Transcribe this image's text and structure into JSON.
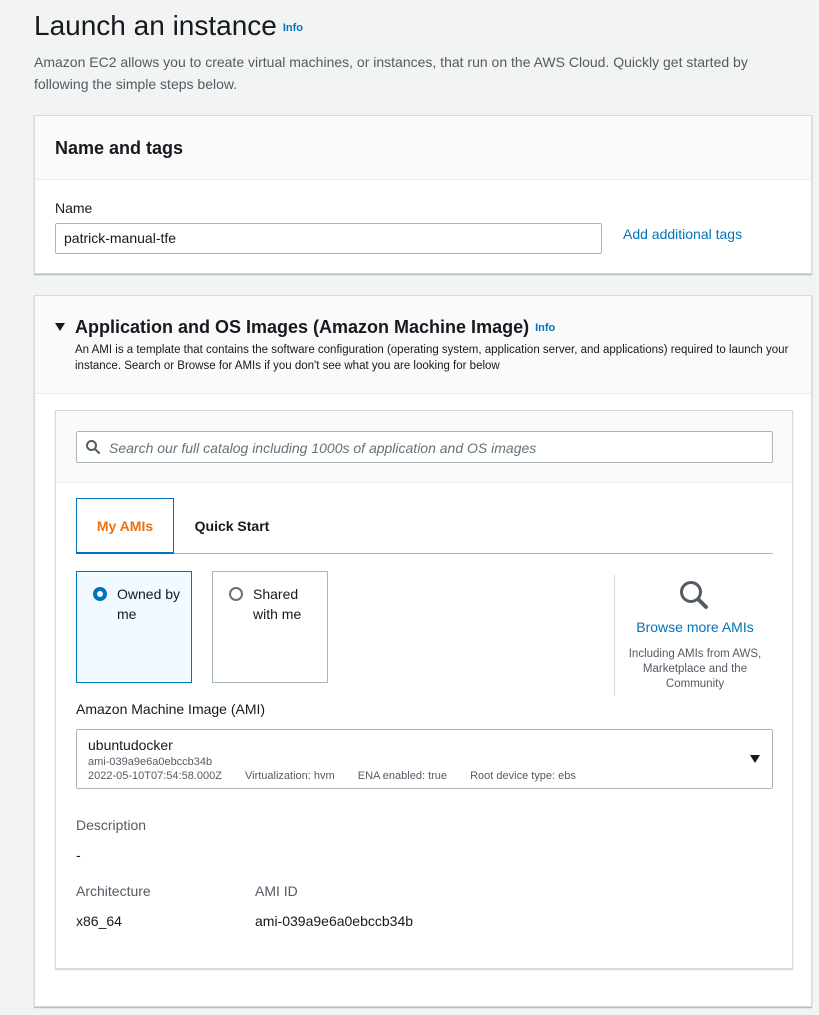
{
  "header": {
    "title": "Launch an instance",
    "info": "Info",
    "description": "Amazon EC2 allows you to create virtual machines, or instances, that run on the AWS Cloud. Quickly get started by following the simple steps below."
  },
  "name_tags": {
    "title": "Name and tags",
    "name_label": "Name",
    "name_value": "patrick-manual-tfe",
    "add_tags": "Add additional tags"
  },
  "ami_section": {
    "title": "Application and OS Images (Amazon Machine Image)",
    "info": "Info",
    "description": "An AMI is a template that contains the software configuration (operating system, application server, and applications) required to launch your instance. Search or Browse for AMIs if you don't see what you are looking for below",
    "search_placeholder": "Search our full catalog including 1000s of application and OS images",
    "tabs": [
      {
        "label": "My AMIs",
        "active": true
      },
      {
        "label": "Quick Start",
        "active": false
      }
    ],
    "owned_by_me": "Owned by me",
    "shared_with_me": "Shared with me",
    "browse_link": "Browse more AMIs",
    "browse_sub": "Including AMIs from AWS, Marketplace and the Community",
    "ami_label": "Amazon Machine Image (AMI)",
    "selected_ami": {
      "name": "ubuntudocker",
      "id": "ami-039a9e6a0ebccb34b",
      "date": "2022-05-10T07:54:58.000Z",
      "virtualization": "Virtualization: hvm",
      "ena": "ENA enabled: true",
      "root_device": "Root device type: ebs"
    },
    "description_label": "Description",
    "description_value": "-",
    "architecture_label": "Architecture",
    "architecture_value": "x86_64",
    "ami_id_label": "AMI ID",
    "ami_id_value": "ami-039a9e6a0ebccb34b"
  },
  "colors": {
    "link": "#0073bb",
    "active_tab_text": "#ec7211",
    "background": "#f2f3f3"
  },
  "icons": [
    "search-icon",
    "magnifier-icon",
    "caret-down-icon"
  ]
}
